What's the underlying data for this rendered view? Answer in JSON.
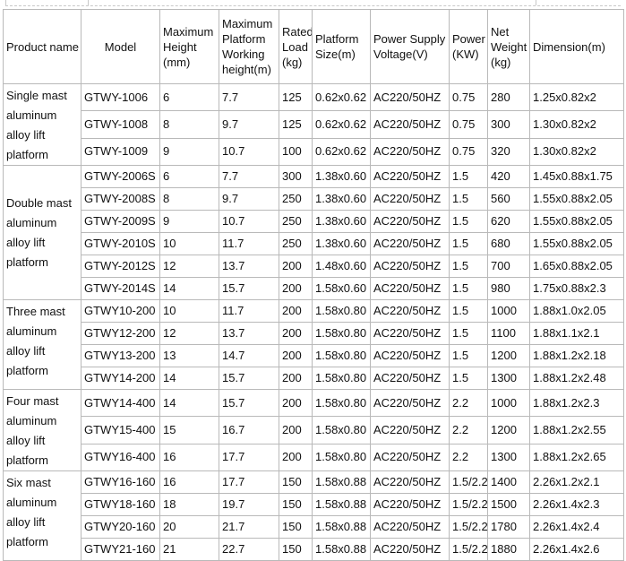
{
  "table": {
    "headers": {
      "product_name": "Product name",
      "model": "Model",
      "max_height": "Maximum Height (mm)",
      "max_platform_working_height": "Maximum Platform Working height(m)",
      "rated_load": "Rated Load (kg)",
      "platform_size": "Platform Size(m)",
      "power_supply_voltage": "Power Supply Voltage(V)",
      "power": "Power (KW)",
      "net_weight": "Net Weight (kg)",
      "dimension": "Dimension(m)"
    },
    "groups": [
      {
        "product_name": "Single mast aluminum alloy lift platform",
        "rows": [
          [
            "GTWY-1006",
            "6",
            "7.7",
            "125",
            "0.62x0.62",
            "AC220/50HZ",
            "0.75",
            "280",
            "1.25x0.82x2"
          ],
          [
            "GTWY-1008",
            "8",
            "9.7",
            "125",
            "0.62x0.62",
            "AC220/50HZ",
            "0.75",
            "300",
            "1.30x0.82x2"
          ],
          [
            "GTWY-1009",
            "9",
            "10.7",
            "100",
            "0.62x0.62",
            "AC220/50HZ",
            "0.75",
            "320",
            "1.30x0.82x2"
          ]
        ]
      },
      {
        "product_name": "Double mast aluminum alloy lift platform",
        "rows": [
          [
            "GTWY-2006S",
            "6",
            "7.7",
            "300",
            "1.38x0.60",
            "AC220/50HZ",
            "1.5",
            "420",
            "1.45x0.88x1.75"
          ],
          [
            "GTWY-2008S",
            "8",
            "9.7",
            "250",
            "1.38x0.60",
            "AC220/50HZ",
            "1.5",
            "560",
            "1.55x0.88x2.05"
          ],
          [
            "GTWY-2009S",
            "9",
            "10.7",
            "250",
            "1.38x0.60",
            "AC220/50HZ",
            "1.5",
            "620",
            "1.55x0.88x2.05"
          ],
          [
            "GTWY-2010S",
            "10",
            "11.7",
            "250",
            "1.38x0.60",
            "AC220/50HZ",
            "1.5",
            "680",
            "1.55x0.88x2.05"
          ],
          [
            "GTWY-2012S",
            "12",
            "13.7",
            "200",
            "1.48x0.60",
            "AC220/50HZ",
            "1.5",
            "700",
            "1.65x0.88x2.05"
          ],
          [
            "GTWY-2014S",
            "14",
            "15.7",
            "200",
            "1.58x0.60",
            "AC220/50HZ",
            "1.5",
            "980",
            "1.75x0.88x2.3"
          ]
        ]
      },
      {
        "product_name": "Three mast aluminum alloy lift platform",
        "rows": [
          [
            "GTWY10-200",
            "10",
            "11.7",
            "200",
            "1.58x0.80",
            "AC220/50HZ",
            "1.5",
            "1000",
            "1.88x1.0x2.05"
          ],
          [
            "GTWY12-200",
            "12",
            "13.7",
            "200",
            "1.58x0.80",
            "AC220/50HZ",
            "1.5",
            "1100",
            "1.88x1.1x2.1"
          ],
          [
            "GTWY13-200",
            "13",
            "14.7",
            "200",
            "1.58x0.80",
            "AC220/50HZ",
            "1.5",
            "1200",
            "1.88x1.2x2.18"
          ],
          [
            "GTWY14-200",
            "14",
            "15.7",
            "200",
            "1.58x0.80",
            "AC220/50HZ",
            "1.5",
            "1300",
            "1.88x1.2x2.48"
          ]
        ]
      },
      {
        "product_name": "Four mast aluminum alloy lift platform",
        "rows": [
          [
            "GTWY14-400",
            "14",
            "15.7",
            "200",
            "1.58x0.80",
            "AC220/50HZ",
            "2.2",
            "1000",
            "1.88x1.2x2.3"
          ],
          [
            "GTWY15-400",
            "15",
            "16.7",
            "200",
            "1.58x0.80",
            "AC220/50HZ",
            "2.2",
            "1200",
            "1.88x1.2x2.55"
          ],
          [
            "GTWY16-400",
            "16",
            "17.7",
            "200",
            "1.58x0.80",
            "AC220/50HZ",
            "2.2",
            "1300",
            "1.88x1.2x2.65"
          ]
        ]
      },
      {
        "product_name": "Six mast aluminum alloy lift platform",
        "rows": [
          [
            "GTWY16-160",
            "16",
            "17.7",
            "150",
            "1.58x0.88",
            "AC220/50HZ",
            "1.5/2.2",
            "1400",
            "2.26x1.2x2.1"
          ],
          [
            "GTWY18-160",
            "18",
            "19.7",
            "150",
            "1.58x0.88",
            "AC220/50HZ",
            "1.5/2.2",
            "1500",
            "2.26x1.4x2.3"
          ],
          [
            "GTWY20-160",
            "20",
            "21.7",
            "150",
            "1.58x0.88",
            "AC220/50HZ",
            "1.5/2.2",
            "1780",
            "2.26x1.4x2.4"
          ],
          [
            "GTWY21-160",
            "21",
            "22.7",
            "150",
            "1.58x0.88",
            "AC220/50HZ",
            "1.5/2.2",
            "1880",
            "2.26x1.4x2.6"
          ]
        ]
      }
    ]
  }
}
